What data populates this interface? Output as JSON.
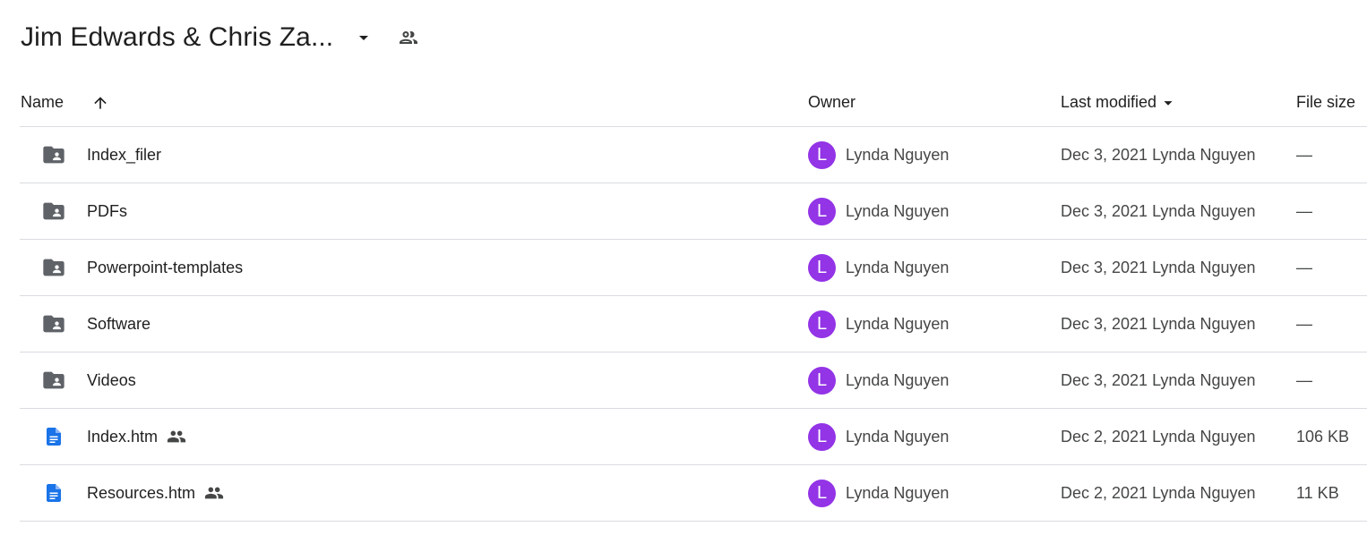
{
  "folder_title": "Jim Edwards & Chris Za...",
  "icons": {
    "dropdown": "arrow-drop-down-icon",
    "shared": "people-icon",
    "sort": "arrow-up-icon",
    "folder": "shared-folder-icon",
    "doc": "google-doc-icon"
  },
  "colors": {
    "avatar_bg": "#9334e6",
    "doc_blue": "#1a73e8",
    "folder_grey": "#5f6368"
  },
  "columns": {
    "name": "Name",
    "owner": "Owner",
    "last_modified": "Last modified",
    "file_size": "File size"
  },
  "files": [
    {
      "name": "Index_filer",
      "type": "folder",
      "shared": false,
      "owner_initial": "L",
      "owner": "Lynda Nguyen",
      "modified": "Dec 3, 2021 Lynda Nguyen",
      "size": "—"
    },
    {
      "name": "PDFs",
      "type": "folder",
      "shared": false,
      "owner_initial": "L",
      "owner": "Lynda Nguyen",
      "modified": "Dec 3, 2021 Lynda Nguyen",
      "size": "—"
    },
    {
      "name": "Powerpoint-templates",
      "type": "folder",
      "shared": false,
      "owner_initial": "L",
      "owner": "Lynda Nguyen",
      "modified": "Dec 3, 2021 Lynda Nguyen",
      "size": "—"
    },
    {
      "name": "Software",
      "type": "folder",
      "shared": false,
      "owner_initial": "L",
      "owner": "Lynda Nguyen",
      "modified": "Dec 3, 2021 Lynda Nguyen",
      "size": "—"
    },
    {
      "name": "Videos",
      "type": "folder",
      "shared": false,
      "owner_initial": "L",
      "owner": "Lynda Nguyen",
      "modified": "Dec 3, 2021 Lynda Nguyen",
      "size": "—"
    },
    {
      "name": "Index.htm",
      "type": "doc",
      "shared": true,
      "owner_initial": "L",
      "owner": "Lynda Nguyen",
      "modified": "Dec 2, 2021 Lynda Nguyen",
      "size": "106 KB"
    },
    {
      "name": "Resources.htm",
      "type": "doc",
      "shared": true,
      "owner_initial": "L",
      "owner": "Lynda Nguyen",
      "modified": "Dec 2, 2021 Lynda Nguyen",
      "size": "11 KB"
    }
  ]
}
